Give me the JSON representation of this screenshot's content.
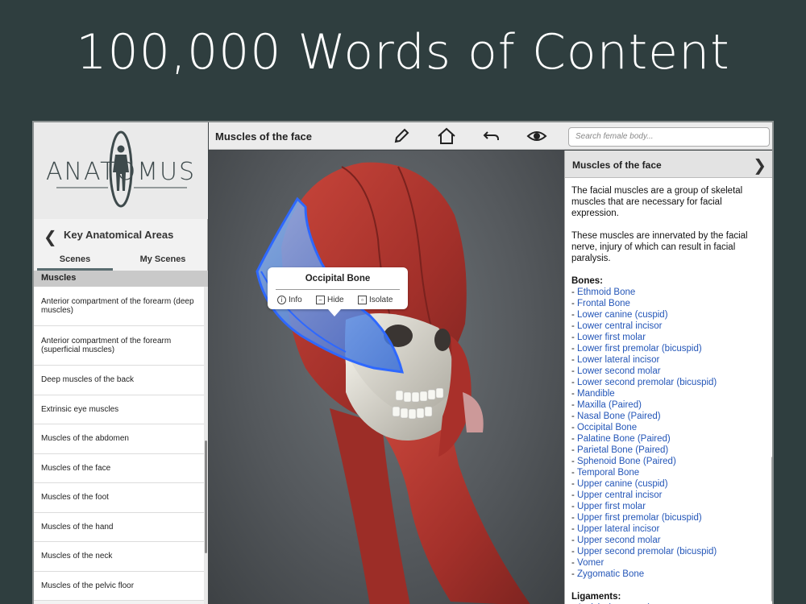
{
  "headline": "100,000 Words of Content",
  "sidebar": {
    "logo_text": "ANATOMUS",
    "nav_title": "Key Anatomical Areas",
    "tabs": [
      "Scenes",
      "My Scenes"
    ],
    "section": "Muscles",
    "items": [
      "Anterior compartment of the forearm (deep muscles)",
      "Anterior compartment of the forearm (superficial muscles)",
      "Deep muscles of the back",
      "Extrinsic eye muscles",
      "Muscles of the abdomen",
      "Muscles of the face",
      "Muscles of the foot",
      "Muscles of the hand",
      "Muscles of the neck",
      "Muscles of the pelvic floor"
    ]
  },
  "toolbar": {
    "title": "Muscles of the face",
    "search_placeholder": "Search female body..."
  },
  "popup": {
    "title": "Occipital Bone",
    "info": "Info",
    "hide": "Hide",
    "isolate": "Isolate"
  },
  "info": {
    "header": "Muscles of the face",
    "para1": "The facial muscles are a group of skeletal muscles that are necessary for facial expression.",
    "para2": "These muscles are innervated by the facial nerve, injury of which can result in facial paralysis.",
    "bones_label": "Bones:",
    "bones": [
      "Ethmoid Bone",
      "Frontal Bone",
      "Lower canine (cuspid)",
      "Lower central incisor",
      "Lower first molar",
      "Lower first premolar (bicuspid)",
      "Lower lateral incisor",
      "Lower second molar",
      "Lower second premolar (bicuspid)",
      "Mandible",
      "Maxilla (Paired)",
      "Nasal Bone (Paired)",
      "Occipital Bone",
      "Palatine Bone (Paired)",
      "Parietal Bone (Paired)",
      "Sphenoid Bone (Paired)",
      "Temporal Bone",
      "Upper canine (cuspid)",
      "Upper central incisor",
      "Upper first molar",
      "Upper first premolar (bicuspid)",
      "Upper lateral incisor",
      "Upper second molar",
      "Upper second premolar (bicuspid)",
      "Vomer",
      "Zygomatic Bone"
    ],
    "ligaments_label": "Ligaments:",
    "ligaments": [
      "Auricle (outer ear)"
    ]
  },
  "colors": {
    "background": "#2f3e3f",
    "link": "#2456b8",
    "muscle": "#b0322b",
    "highlight": "#3f7ee8"
  }
}
